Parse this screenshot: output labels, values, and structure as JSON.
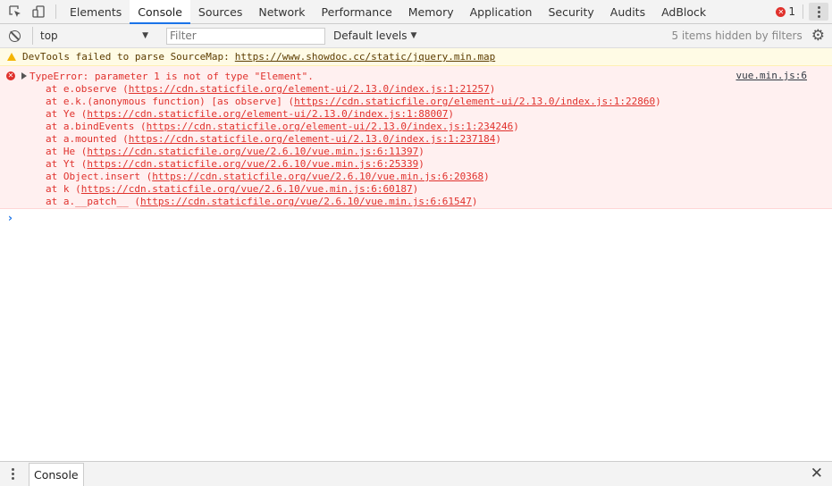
{
  "tabs": [
    {
      "label": "Elements"
    },
    {
      "label": "Console"
    },
    {
      "label": "Sources"
    },
    {
      "label": "Network"
    },
    {
      "label": "Performance"
    },
    {
      "label": "Memory"
    },
    {
      "label": "Application"
    },
    {
      "label": "Security"
    },
    {
      "label": "Audits"
    },
    {
      "label": "AdBlock"
    }
  ],
  "active_tab": "Console",
  "error_count": "1",
  "toolbar": {
    "context": "top",
    "filter_placeholder": "Filter",
    "levels": "Default levels",
    "hidden_info": "5 items hidden by filters"
  },
  "warning": {
    "text": "DevTools failed to parse SourceMap:",
    "link": "https://www.showdoc.cc/static/jquery.min.map"
  },
  "error": {
    "message": "TypeError: parameter 1 is not of type \"Element\".",
    "source": "vue.min.js:6",
    "stack": [
      {
        "fn": "at e.observe (",
        "url": "https://cdn.staticfile.org/element-ui/2.13.0/index.js:1:21257",
        "end": ")"
      },
      {
        "fn": "at e.k.(anonymous function) [as observe] (",
        "url": "https://cdn.staticfile.org/element-ui/2.13.0/index.js:1:22860",
        "end": ")"
      },
      {
        "fn": "at Ye (",
        "url": "https://cdn.staticfile.org/element-ui/2.13.0/index.js:1:88007",
        "end": ")"
      },
      {
        "fn": "at a.bindEvents (",
        "url": "https://cdn.staticfile.org/element-ui/2.13.0/index.js:1:234246",
        "end": ")"
      },
      {
        "fn": "at a.mounted (",
        "url": "https://cdn.staticfile.org/element-ui/2.13.0/index.js:1:237184",
        "end": ")"
      },
      {
        "fn": "at He (",
        "url": "https://cdn.staticfile.org/vue/2.6.10/vue.min.js:6:11397",
        "end": ")"
      },
      {
        "fn": "at Yt (",
        "url": "https://cdn.staticfile.org/vue/2.6.10/vue.min.js:6:25339",
        "end": ")"
      },
      {
        "fn": "at Object.insert (",
        "url": "https://cdn.staticfile.org/vue/2.6.10/vue.min.js:6:20368",
        "end": ")"
      },
      {
        "fn": "at k (",
        "url": "https://cdn.staticfile.org/vue/2.6.10/vue.min.js:6:60187",
        "end": ")"
      },
      {
        "fn": "at a.__patch__ (",
        "url": "https://cdn.staticfile.org/vue/2.6.10/vue.min.js:6:61547",
        "end": ")"
      }
    ]
  },
  "drawer": {
    "tab": "Console"
  },
  "colors": {
    "accent": "#1a73e8",
    "error": "#e0312c",
    "warning": "#f4b400"
  }
}
